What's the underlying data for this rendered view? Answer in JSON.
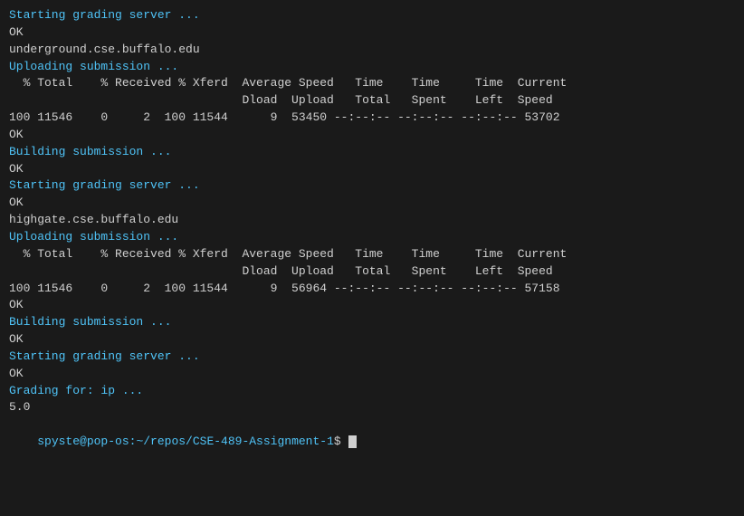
{
  "terminal": {
    "lines": [
      {
        "text": "Starting grading server ...",
        "class": "cyan"
      },
      {
        "text": "OK",
        "class": "normal"
      },
      {
        "text": "",
        "class": "normal"
      },
      {
        "text": "underground.cse.buffalo.edu",
        "class": "normal"
      },
      {
        "text": "Uploading submission ...",
        "class": "cyan"
      },
      {
        "text": "  % Total    % Received % Xferd  Average Speed   Time    Time     Time  Current",
        "class": "normal"
      },
      {
        "text": "                                 Dload  Upload   Total   Spent    Left  Speed",
        "class": "normal"
      },
      {
        "text": "100 11546    0     2  100 11544      9  53450 --:--:-- --:--:-- --:--:-- 53702",
        "class": "normal"
      },
      {
        "text": "OK",
        "class": "normal"
      },
      {
        "text": "Building submission ...",
        "class": "cyan"
      },
      {
        "text": "OK",
        "class": "normal"
      },
      {
        "text": "Starting grading server ...",
        "class": "cyan"
      },
      {
        "text": "OK",
        "class": "normal"
      },
      {
        "text": "",
        "class": "normal"
      },
      {
        "text": "highgate.cse.buffalo.edu",
        "class": "normal"
      },
      {
        "text": "Uploading submission ...",
        "class": "cyan"
      },
      {
        "text": "  % Total    % Received % Xferd  Average Speed   Time    Time     Time  Current",
        "class": "normal"
      },
      {
        "text": "                                 Dload  Upload   Total   Spent    Left  Speed",
        "class": "normal"
      },
      {
        "text": "100 11546    0     2  100 11544      9  56964 --:--:-- --:--:-- --:--:-- 57158",
        "class": "normal"
      },
      {
        "text": "OK",
        "class": "normal"
      },
      {
        "text": "Building submission ...",
        "class": "cyan"
      },
      {
        "text": "OK",
        "class": "normal"
      },
      {
        "text": "Starting grading server ...",
        "class": "cyan"
      },
      {
        "text": "OK",
        "class": "normal"
      },
      {
        "text": "",
        "class": "normal"
      },
      {
        "text": "Grading for: ip ...",
        "class": "cyan"
      },
      {
        "text": "5.0",
        "class": "normal"
      }
    ],
    "prompt": {
      "user_host": "spyste@pop-os",
      "separator": ":",
      "path": "~/repos/CSE-489-Assignment-1",
      "symbol": "$"
    }
  }
}
